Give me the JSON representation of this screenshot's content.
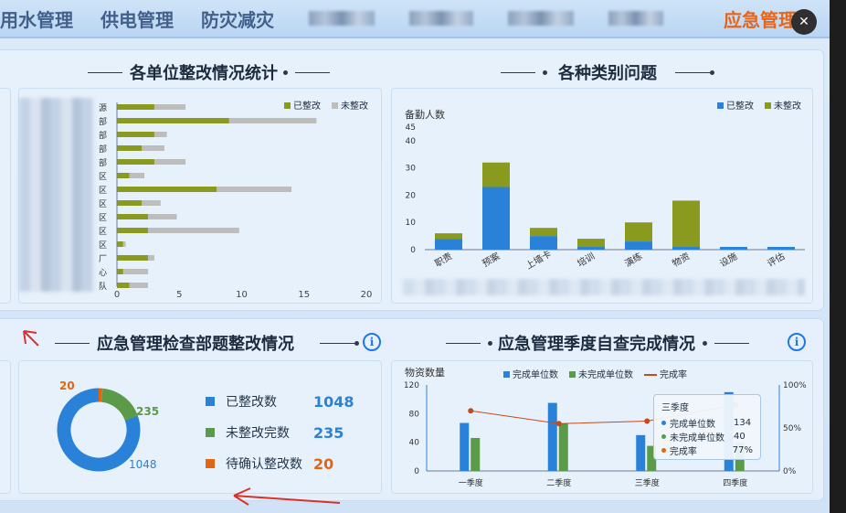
{
  "nav": {
    "items": [
      "用水管理",
      "供电管理",
      "防灾减灾"
    ],
    "active": "应急管理"
  },
  "sections": {
    "rectify_stats_title": "各单位整改情况统计",
    "category_title": "各种类别问题",
    "dept_title": "应急管理检查部题整改情况",
    "quarter_title": "应急管理季度自查完成情况"
  },
  "rectify_chart": {
    "legend": [
      "已整改",
      "未整改"
    ],
    "row_labels": [
      "源",
      "部",
      "部",
      "部",
      "部",
      "区",
      "区",
      "区",
      "区",
      "区",
      "区",
      "厂",
      "心",
      "队"
    ],
    "x_ticks": [
      "0",
      "5",
      "10",
      "15",
      "20"
    ]
  },
  "category_chart": {
    "legend": [
      "已整改",
      "未整改"
    ],
    "ylabel": "备勤人数",
    "y_ticks": [
      "45",
      "40",
      "30",
      "20",
      "10",
      "0"
    ],
    "x_labels": [
      "职责",
      "预案",
      "上墙卡",
      "培训",
      "演练",
      "物资",
      "设施",
      "评估"
    ]
  },
  "dept_stats": {
    "donut_labels": {
      "top": "20",
      "right": "235",
      "bottom": "1048"
    },
    "rows": [
      {
        "label": "已整改数",
        "value": "1048",
        "color": "#2a82d8"
      },
      {
        "label": "未整改完数",
        "value": "235",
        "color": "#5b9a48"
      },
      {
        "label": "待确认整改数",
        "value": "20",
        "color": "#e06712"
      }
    ]
  },
  "quarter_chart": {
    "ylabel": "物资数量",
    "legend": [
      "完成单位数",
      "未完成单位数",
      "完成率"
    ],
    "y_ticks": [
      "120",
      "80",
      "40",
      "0"
    ],
    "y2_ticks": [
      "100%",
      "50%",
      "0%"
    ],
    "categories": [
      "一季度",
      "二季度",
      "三季度",
      "四季度"
    ],
    "tooltip": {
      "title": "三季度",
      "rows": [
        {
          "label": "完成单位数",
          "value": "134"
        },
        {
          "label": "未完成单位数",
          "value": "40"
        },
        {
          "label": "完成率",
          "value": "77%"
        }
      ]
    }
  },
  "colors": {
    "done": "#8a9a1e",
    "not_done": "#bdbdbd",
    "blue": "#2a82d8",
    "green": "#5b9a48",
    "orange": "#e06712"
  },
  "chart_data": [
    {
      "type": "bar",
      "orientation": "horizontal",
      "stacked": true,
      "title": "各单位整改情况统计",
      "categories": [
        "源",
        "部",
        "部",
        "部",
        "部",
        "区",
        "区",
        "区",
        "区",
        "区",
        "区",
        "厂",
        "心",
        "队"
      ],
      "series": [
        {
          "name": "已整改",
          "values": [
            3,
            9,
            3,
            2,
            3,
            1,
            8,
            2,
            2.5,
            2.5,
            0.5,
            2.5,
            0.5,
            1
          ]
        },
        {
          "name": "未整改",
          "values": [
            2.5,
            7,
            1,
            1.8,
            2.5,
            1.2,
            6,
            1.5,
            2.3,
            7.3,
            0.2,
            0.5,
            2,
            1.5
          ]
        }
      ],
      "xlim": [
        0,
        20
      ]
    },
    {
      "type": "bar",
      "stacked": true,
      "title": "各种类别问题",
      "ylabel": "备勤人数",
      "categories": [
        "职责",
        "预案",
        "上墙卡",
        "培训",
        "演练",
        "物资",
        "设施",
        "评估"
      ],
      "series": [
        {
          "name": "已整改",
          "values": [
            4,
            23,
            5,
            1,
            3,
            1,
            1,
            1
          ]
        },
        {
          "name": "未整改",
          "values": [
            2,
            9,
            3,
            3,
            7,
            17,
            0,
            0
          ]
        }
      ],
      "ylim": [
        0,
        45
      ]
    },
    {
      "type": "pie",
      "title": "应急管理检查部题整改情况",
      "labels": [
        "已整改数",
        "未整改完数",
        "待确认整改数"
      ],
      "values": [
        1048,
        235,
        20
      ]
    },
    {
      "type": "bar",
      "title": "应急管理季度自查完成情况",
      "ylabel": "物资数量",
      "categories": [
        "一季度",
        "二季度",
        "三季度",
        "四季度"
      ],
      "series": [
        {
          "name": "完成单位数",
          "values": [
            67,
            95,
            50,
            110
          ]
        },
        {
          "name": "未完成单位数",
          "values": [
            46,
            66,
            35,
            40
          ]
        },
        {
          "name": "完成率",
          "values": [
            70,
            55,
            58,
            77
          ],
          "type": "line",
          "axis": "right"
        }
      ],
      "ylim": [
        0,
        120
      ],
      "y2lim": [
        0,
        100
      ]
    }
  ]
}
